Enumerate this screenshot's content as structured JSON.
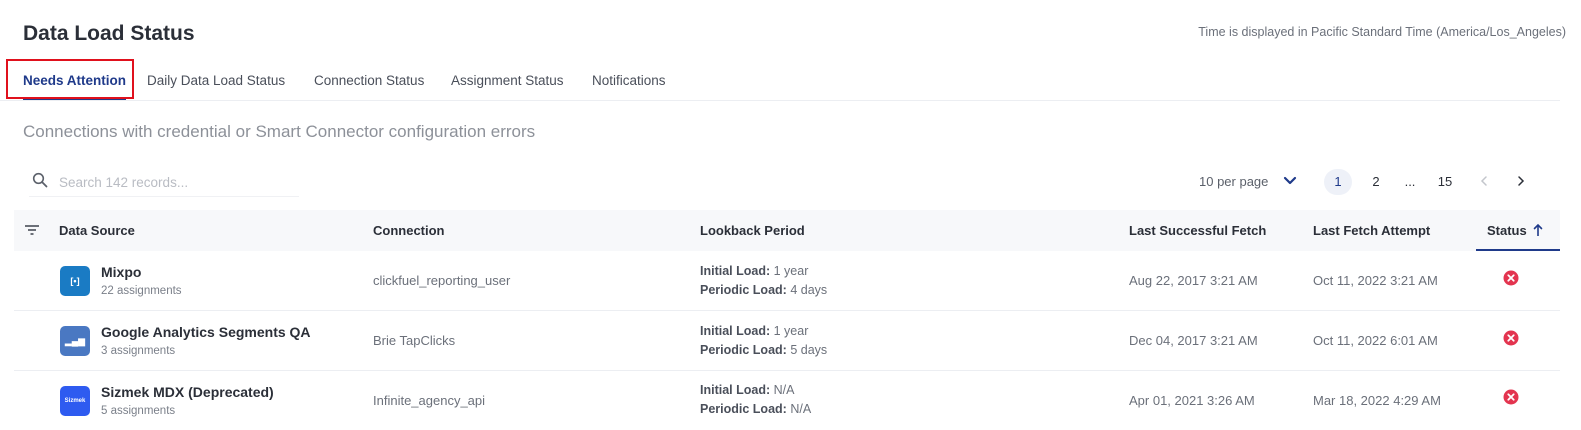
{
  "page": {
    "title": "Data Load Status",
    "timezone_note": "Time is displayed in Pacific Standard Time (America/Los_Angeles)",
    "subtitle": "Connections with credential or Smart Connector configuration errors"
  },
  "tabs": [
    {
      "label": "Needs Attention",
      "active": true
    },
    {
      "label": "Daily Data Load Status",
      "active": false
    },
    {
      "label": "Connection Status",
      "active": false
    },
    {
      "label": "Assignment Status",
      "active": false
    },
    {
      "label": "Notifications",
      "active": false
    }
  ],
  "search": {
    "placeholder": "Search 142 records...",
    "value": ""
  },
  "pagination": {
    "per_page": "10 per page",
    "pages": [
      "1",
      "2",
      "...",
      "15"
    ],
    "current": "1"
  },
  "table": {
    "columns": {
      "data_source": "Data Source",
      "connection": "Connection",
      "lookback": "Lookback Period",
      "last_success": "Last Successful Fetch",
      "last_attempt": "Last Fetch Attempt",
      "status": "Status"
    },
    "status_sort": "ascending",
    "lookback_labels": {
      "initial": "Initial Load:",
      "periodic": "Periodic Load:"
    },
    "rows": [
      {
        "name": "Mixpo",
        "assignments": "22 assignments",
        "logo_text": "[•]",
        "logo_color": "#1a7bc4",
        "connection": "clickfuel_reporting_user",
        "initial": "1 year",
        "periodic": "4 days",
        "last_success": "Aug 22, 2017 3:21 AM",
        "last_attempt": "Oct 11, 2022 3:21 AM",
        "status": "error"
      },
      {
        "name": "Google Analytics Segments QA",
        "assignments": "3 assignments",
        "logo_text": "▂▄▆",
        "logo_color": "#4a78c2",
        "connection": "Brie TapClicks",
        "initial": "1 year",
        "periodic": "5 days",
        "last_success": "Dec 04, 2017 3:21 AM",
        "last_attempt": "Oct 11, 2022 6:01 AM",
        "status": "error"
      },
      {
        "name": "Sizmek MDX (Deprecated)",
        "assignments": "5 assignments",
        "logo_text": "Sizmek",
        "logo_color": "#2e5bf0",
        "connection": "Infinite_agency_api",
        "initial": "N/A",
        "periodic": "N/A",
        "last_success": "Apr 01, 2021 3:26 AM",
        "last_attempt": "Mar 18, 2022 4:29 AM",
        "status": "error"
      }
    ]
  },
  "colors": {
    "accent": "#1f3a8a",
    "error": "#e3344f",
    "highlight": "#e0111d"
  }
}
